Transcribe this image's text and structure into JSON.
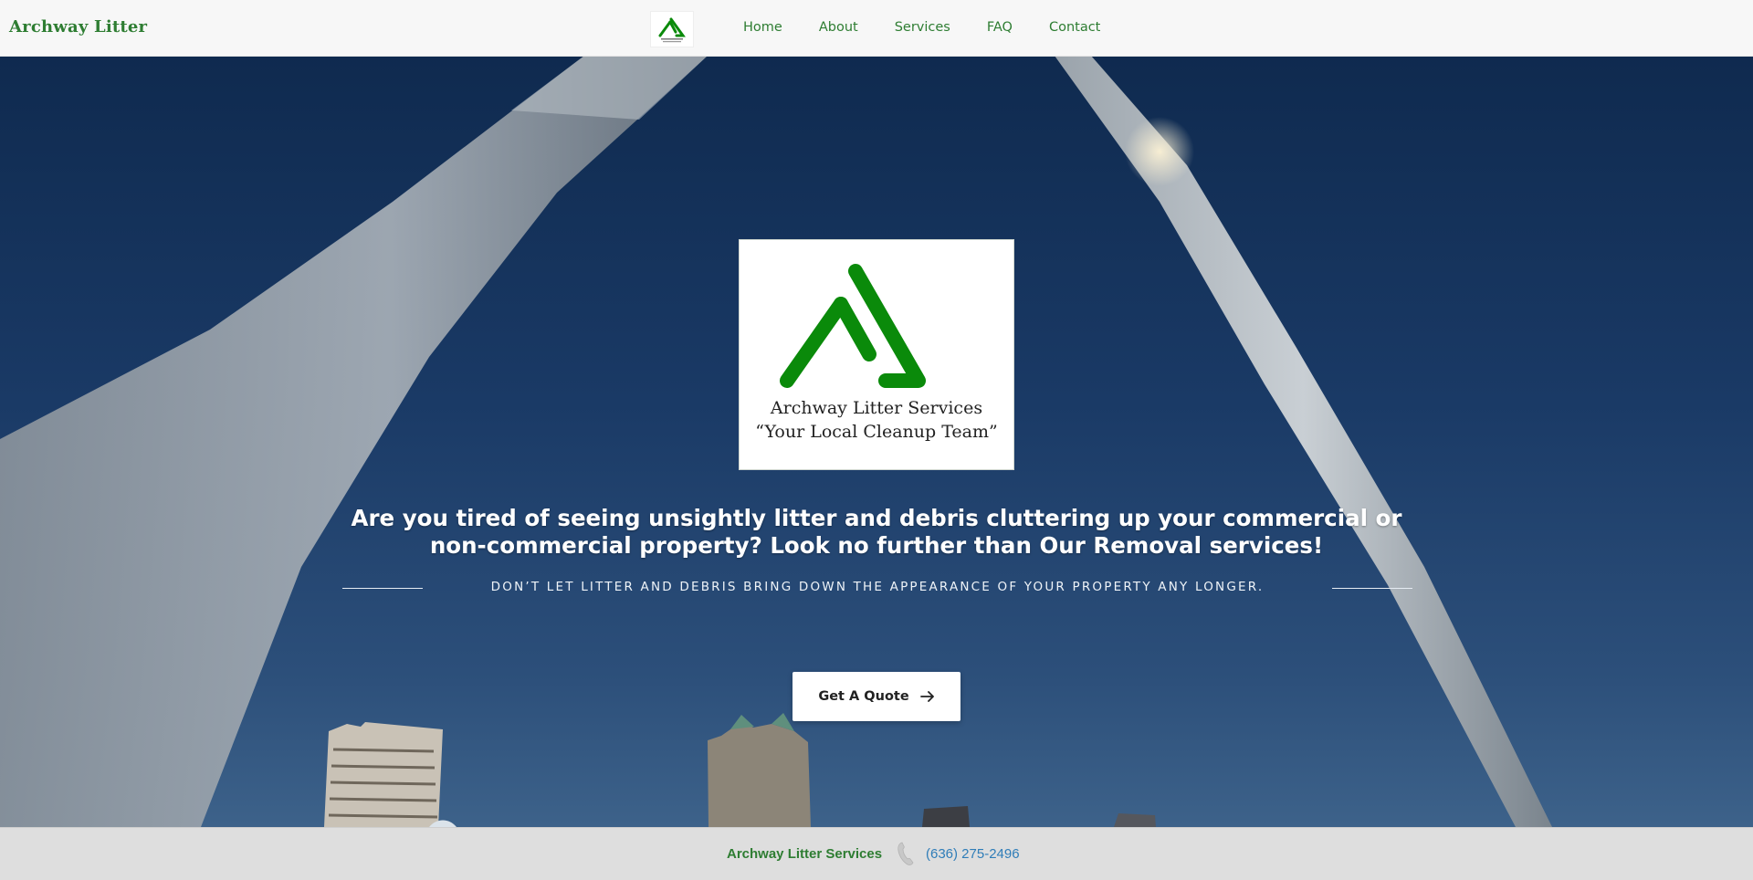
{
  "header": {
    "brand": "Archway Litter",
    "nav": [
      "Home",
      "About",
      "Services",
      "FAQ",
      "Contact"
    ]
  },
  "hero": {
    "logo_name": "Archway Litter Services",
    "logo_tagline": "“Your Local Cleanup Team”",
    "headline": "Are you tired of seeing unsightly litter and debris cluttering up your commercial or non-commercial property? Look no further than Our Removal services!",
    "subline": "DON’T LET LITTER AND DEBRIS BRING DOWN THE APPEARANCE OF YOUR PROPERTY ANY LONGER.",
    "cta": "Get A Quote"
  },
  "footer": {
    "name": "Archway Litter Services",
    "phone": "(636) 275-2496"
  },
  "icons": {
    "logo": "archway-triangle-logo",
    "cta_arrow": "arrow-right-icon",
    "phone": "phone-icon"
  },
  "colors": {
    "brand_green": "#2e7d32",
    "logo_green": "#0a8a0a",
    "phone_blue": "#2f7db8",
    "sky": "#1a3a66"
  }
}
